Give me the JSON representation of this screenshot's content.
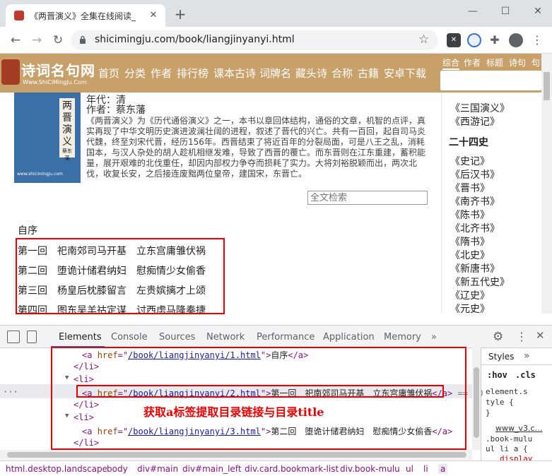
{
  "browser": {
    "tab_title": "《两晋演义》全集在线阅读_史书",
    "url": "shicimingju.com/book/liangjinyanyi.html"
  },
  "site": {
    "logo_text": "诗词名句网",
    "logo_sub": "Www.ShiCiMingJu.Com",
    "nav": [
      "首页",
      "分类",
      "作者",
      "排行榜",
      "课本古诗",
      "词牌名",
      "藏头诗",
      "合称",
      "古籍",
      "安卓下载"
    ],
    "search_tabs": [
      "综合",
      "作者",
      "标题",
      "诗句",
      "句"
    ]
  },
  "book": {
    "cover_chars": [
      "两",
      "晋",
      "演",
      "义"
    ],
    "cover_sub": "蔡东藩",
    "cover_url": "www.shicimingju.com",
    "dynasty": "年代：清",
    "author": "作者：蔡东藩",
    "description": "《两晋演义》为《历代通俗演义》之一，本书以章回体结构，通俗的文章，机智的点评，真实再现了中华文明历史演进波澜壮阔的进程，叙述了晋代的兴亡。共有一百回，起自司马炎代魏，终至刘宋代晋，经历156年。西晋结束了将近百年的分裂局面，可是八王之乱，消耗国本，与汉人杂处的胡人趁机相继发难，导致了西晋的覆亡。而东晋则在江东重建，蓄积能量，展开艰难的北伐重任，却因内部权力争夺而损耗了实力。大将刘裕脱颖而出，两次北伐，收复长安，之后接连废黜两位皇帝，建国宋，东晋亡。",
    "fulltext_placeholder": "全文检索",
    "toc": [
      "自序",
      "第一回　祀南郊司马开基　立东宫庸雏伏祸",
      "第二回　堕诡计储君纳妇　慰痴情少女偷香",
      "第三回　杨皇后枕膝留言　左贵嫔摛才上颂",
      "第四回　图东吴羊祜定谋　讨西虏马隆奏捷"
    ]
  },
  "right_list": {
    "top_items": [
      "《三国演义》",
      "《西游记》"
    ],
    "heading": "二十四史",
    "items": [
      "《史记》",
      "《后汉书》",
      "《晋书》",
      "《南齐书》",
      "《陈书》",
      "《北齐书》",
      "《隋书》",
      "《北史》",
      "《新唐书》",
      "《新五代史》",
      "《辽史》",
      "《元史》"
    ]
  },
  "devtools": {
    "tabs": [
      "Elements",
      "Console",
      "Sources",
      "Network",
      "Performance",
      "Application",
      "Memory",
      "»"
    ],
    "lines": [
      {
        "type": "a",
        "href": "/book/liangjinyanyi/1.html",
        "text": "自序"
      },
      {
        "type": "close",
        "tag": "</li>"
      },
      {
        "type": "open",
        "tag": "<li>"
      },
      {
        "type": "a",
        "href": "/book/liangjinyanyi/2.html",
        "text": "第一回　祀南郊司马开基　立东宫庸雏伏祸",
        "suffix": "== $0"
      },
      {
        "type": "close",
        "tag": "</li>"
      },
      {
        "type": "open",
        "tag": "<li>"
      },
      {
        "type": "a",
        "href": "/book/liangjinyanyi/3.html",
        "text": "第二回　堕诡计储君纳妇　慰痴情少女偷香"
      },
      {
        "type": "close",
        "tag": "</li>"
      }
    ],
    "annotation": "获取a标签提取目录链接与目录title",
    "styles_tab": "Styles",
    "styles_more": "»",
    "hov": ":hov",
    "cls": ".cls",
    "element_style_1": "element.s",
    "element_style_2": "tyle {",
    "element_style_3": "}",
    "rule_source": "www_v3.c…",
    "rule_selector_1": ".book-mulu",
    "rule_selector_2": "ul li a {",
    "rule_prop": "display",
    "rule_colon": ":",
    "breadcrumb": [
      "html.desktop.landscape",
      "body",
      "div#main",
      "div#main_left",
      "div.card.bookmark-list",
      "div.book-mulu",
      "ul",
      "li",
      "a"
    ]
  }
}
